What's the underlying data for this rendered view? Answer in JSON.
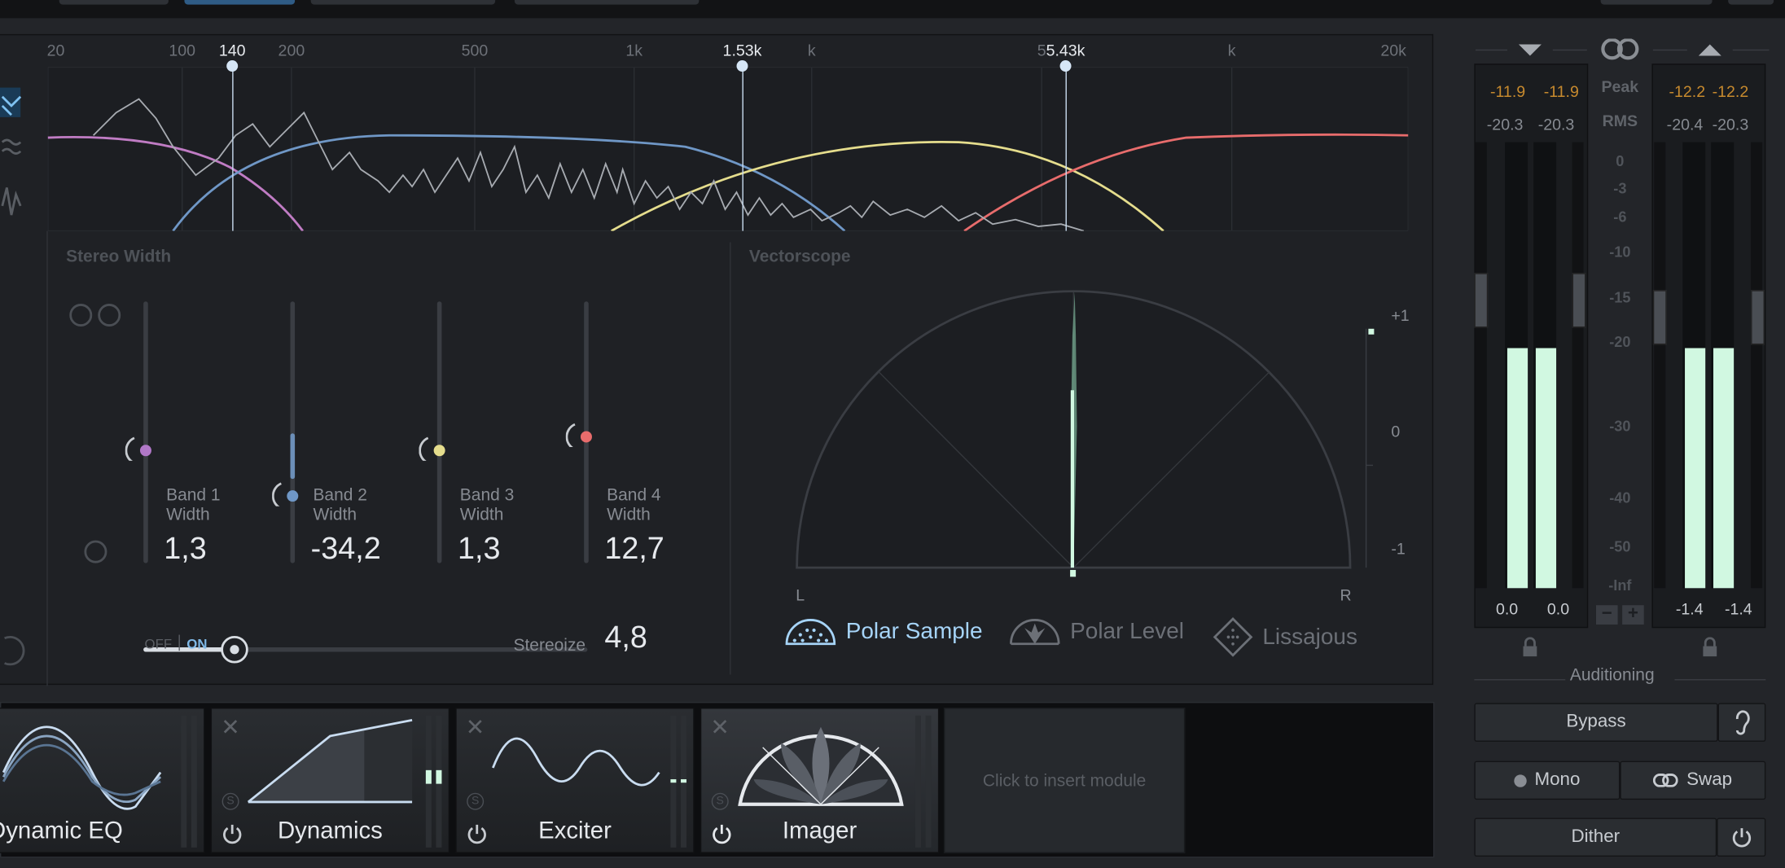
{
  "spectrum": {
    "freq_labels": [
      {
        "text": "20",
        "pos": 49
      },
      {
        "text": "100",
        "pos": 160
      },
      {
        "text": "200",
        "pos": 256
      },
      {
        "text": "500",
        "pos": 417
      },
      {
        "text": "1k",
        "pos": 557
      },
      {
        "text": "k",
        "pos": 713
      },
      {
        "text": "5",
        "pos": 915
      },
      {
        "text": "k",
        "pos": 1082
      },
      {
        "text": "20k",
        "pos": 1224
      }
    ],
    "crossovers": [
      {
        "label": "140",
        "pos": 204
      },
      {
        "label": "1.53k",
        "pos": 652
      },
      {
        "label": "5.43k",
        "pos": 936
      }
    ]
  },
  "stereo_width": {
    "title": "Stereo Width",
    "bands": [
      {
        "name": "Band 1",
        "sub": "Width",
        "value": "1,3",
        "color": "#b178c8"
      },
      {
        "name": "Band 2",
        "sub": "Width",
        "value": "-34,2",
        "color": "#6f97c6"
      },
      {
        "name": "Band 3",
        "sub": "Width",
        "value": "1,3",
        "color": "#e5dd8d"
      },
      {
        "name": "Band 4",
        "sub": "Width",
        "value": "12,7",
        "color": "#e86c6c"
      }
    ],
    "off_label": "OFF",
    "on_label": "ON",
    "stereoize_label": "Stereoize",
    "stereoize_value": "4,8"
  },
  "vectorscope": {
    "title": "Vectorscope",
    "scale": [
      "+1",
      "0",
      "-1"
    ],
    "left": "L",
    "right": "R",
    "tabs": [
      {
        "label": "Polar Sample",
        "active": true
      },
      {
        "label": "Polar Level",
        "active": false
      },
      {
        "label": "Lissajous",
        "active": false
      }
    ]
  },
  "meters": {
    "input": {
      "peak_l": "-11.9",
      "peak_r": "-11.9",
      "rms_l": "-20.3",
      "rms_r": "-20.3",
      "out_l": "0.0",
      "out_r": "0.0"
    },
    "output": {
      "peak_l": "-12.2",
      "peak_r": "-12.2",
      "rms_l": "-20.4",
      "rms_r": "-20.3",
      "out_l": "-1.4",
      "out_r": "-1.4"
    },
    "peak_label": "Peak",
    "rms_label": "RMS",
    "scale": [
      "0",
      "-3",
      "-6",
      "-10",
      "-15",
      "-20",
      "-30",
      "-40",
      "-50",
      "-Inf"
    ]
  },
  "auditioning": {
    "title": "Auditioning",
    "bypass": "Bypass",
    "mono": "Mono",
    "swap": "Swap",
    "dither": "Dither"
  },
  "chain": {
    "modules": [
      {
        "name": "Dynamic EQ"
      },
      {
        "name": "Dynamics"
      },
      {
        "name": "Exciter"
      },
      {
        "name": "Imager"
      }
    ],
    "insert_label": "Click to insert module"
  }
}
